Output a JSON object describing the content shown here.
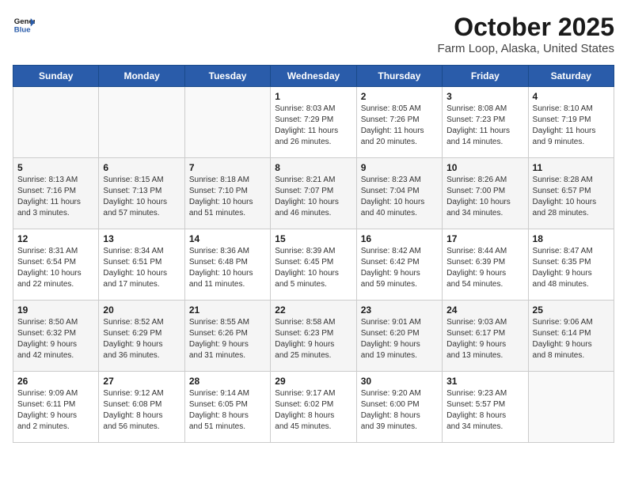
{
  "header": {
    "logo_line1": "General",
    "logo_line2": "Blue",
    "title": "October 2025",
    "subtitle": "Farm Loop, Alaska, United States"
  },
  "days_of_week": [
    "Sunday",
    "Monday",
    "Tuesday",
    "Wednesday",
    "Thursday",
    "Friday",
    "Saturday"
  ],
  "weeks": [
    [
      {
        "day": "",
        "info": ""
      },
      {
        "day": "",
        "info": ""
      },
      {
        "day": "",
        "info": ""
      },
      {
        "day": "1",
        "info": "Sunrise: 8:03 AM\nSunset: 7:29 PM\nDaylight: 11 hours\nand 26 minutes."
      },
      {
        "day": "2",
        "info": "Sunrise: 8:05 AM\nSunset: 7:26 PM\nDaylight: 11 hours\nand 20 minutes."
      },
      {
        "day": "3",
        "info": "Sunrise: 8:08 AM\nSunset: 7:23 PM\nDaylight: 11 hours\nand 14 minutes."
      },
      {
        "day": "4",
        "info": "Sunrise: 8:10 AM\nSunset: 7:19 PM\nDaylight: 11 hours\nand 9 minutes."
      }
    ],
    [
      {
        "day": "5",
        "info": "Sunrise: 8:13 AM\nSunset: 7:16 PM\nDaylight: 11 hours\nand 3 minutes."
      },
      {
        "day": "6",
        "info": "Sunrise: 8:15 AM\nSunset: 7:13 PM\nDaylight: 10 hours\nand 57 minutes."
      },
      {
        "day": "7",
        "info": "Sunrise: 8:18 AM\nSunset: 7:10 PM\nDaylight: 10 hours\nand 51 minutes."
      },
      {
        "day": "8",
        "info": "Sunrise: 8:21 AM\nSunset: 7:07 PM\nDaylight: 10 hours\nand 46 minutes."
      },
      {
        "day": "9",
        "info": "Sunrise: 8:23 AM\nSunset: 7:04 PM\nDaylight: 10 hours\nand 40 minutes."
      },
      {
        "day": "10",
        "info": "Sunrise: 8:26 AM\nSunset: 7:00 PM\nDaylight: 10 hours\nand 34 minutes."
      },
      {
        "day": "11",
        "info": "Sunrise: 8:28 AM\nSunset: 6:57 PM\nDaylight: 10 hours\nand 28 minutes."
      }
    ],
    [
      {
        "day": "12",
        "info": "Sunrise: 8:31 AM\nSunset: 6:54 PM\nDaylight: 10 hours\nand 22 minutes."
      },
      {
        "day": "13",
        "info": "Sunrise: 8:34 AM\nSunset: 6:51 PM\nDaylight: 10 hours\nand 17 minutes."
      },
      {
        "day": "14",
        "info": "Sunrise: 8:36 AM\nSunset: 6:48 PM\nDaylight: 10 hours\nand 11 minutes."
      },
      {
        "day": "15",
        "info": "Sunrise: 8:39 AM\nSunset: 6:45 PM\nDaylight: 10 hours\nand 5 minutes."
      },
      {
        "day": "16",
        "info": "Sunrise: 8:42 AM\nSunset: 6:42 PM\nDaylight: 9 hours\nand 59 minutes."
      },
      {
        "day": "17",
        "info": "Sunrise: 8:44 AM\nSunset: 6:39 PM\nDaylight: 9 hours\nand 54 minutes."
      },
      {
        "day": "18",
        "info": "Sunrise: 8:47 AM\nSunset: 6:35 PM\nDaylight: 9 hours\nand 48 minutes."
      }
    ],
    [
      {
        "day": "19",
        "info": "Sunrise: 8:50 AM\nSunset: 6:32 PM\nDaylight: 9 hours\nand 42 minutes."
      },
      {
        "day": "20",
        "info": "Sunrise: 8:52 AM\nSunset: 6:29 PM\nDaylight: 9 hours\nand 36 minutes."
      },
      {
        "day": "21",
        "info": "Sunrise: 8:55 AM\nSunset: 6:26 PM\nDaylight: 9 hours\nand 31 minutes."
      },
      {
        "day": "22",
        "info": "Sunrise: 8:58 AM\nSunset: 6:23 PM\nDaylight: 9 hours\nand 25 minutes."
      },
      {
        "day": "23",
        "info": "Sunrise: 9:01 AM\nSunset: 6:20 PM\nDaylight: 9 hours\nand 19 minutes."
      },
      {
        "day": "24",
        "info": "Sunrise: 9:03 AM\nSunset: 6:17 PM\nDaylight: 9 hours\nand 13 minutes."
      },
      {
        "day": "25",
        "info": "Sunrise: 9:06 AM\nSunset: 6:14 PM\nDaylight: 9 hours\nand 8 minutes."
      }
    ],
    [
      {
        "day": "26",
        "info": "Sunrise: 9:09 AM\nSunset: 6:11 PM\nDaylight: 9 hours\nand 2 minutes."
      },
      {
        "day": "27",
        "info": "Sunrise: 9:12 AM\nSunset: 6:08 PM\nDaylight: 8 hours\nand 56 minutes."
      },
      {
        "day": "28",
        "info": "Sunrise: 9:14 AM\nSunset: 6:05 PM\nDaylight: 8 hours\nand 51 minutes."
      },
      {
        "day": "29",
        "info": "Sunrise: 9:17 AM\nSunset: 6:02 PM\nDaylight: 8 hours\nand 45 minutes."
      },
      {
        "day": "30",
        "info": "Sunrise: 9:20 AM\nSunset: 6:00 PM\nDaylight: 8 hours\nand 39 minutes."
      },
      {
        "day": "31",
        "info": "Sunrise: 9:23 AM\nSunset: 5:57 PM\nDaylight: 8 hours\nand 34 minutes."
      },
      {
        "day": "",
        "info": ""
      }
    ]
  ]
}
